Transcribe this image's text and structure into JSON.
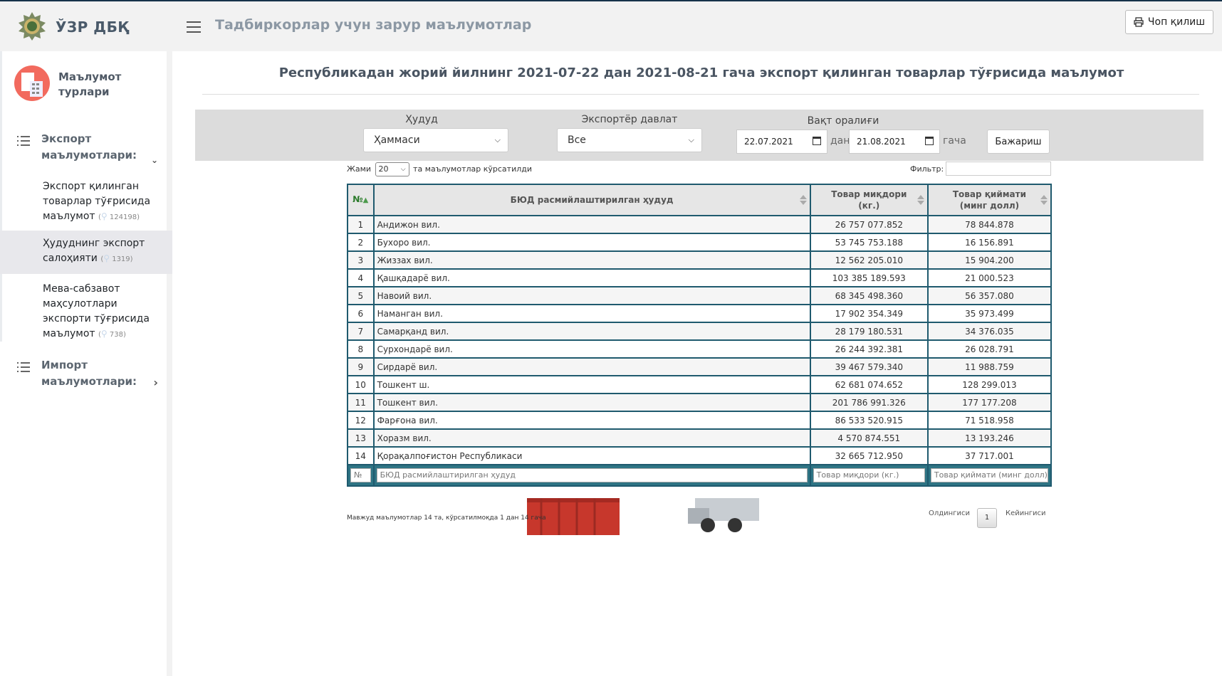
{
  "app": {
    "brand": "ЎЗР ДБҚ",
    "heading": "Тадбиркорлар учун зарур маълумотлар",
    "print_label": "Чоп қилиш"
  },
  "sidebar": {
    "title": "Маълумот турлари",
    "export_group": {
      "label": "Экспорт маълумотлари:"
    },
    "items": [
      {
        "label": "Экспорт қилинган товарлар тўғрисида маълумот",
        "count": "124198"
      },
      {
        "label": "Ҳududнинг экспорт салоҳияти",
        "count": "1319"
      },
      {
        "label": "Мева-сабзавот маҳсулотлари экспорти тўғрисида маълумот",
        "count": "738"
      }
    ],
    "import_group": {
      "label": "Импорт маълумотлари:"
    }
  },
  "main": {
    "title": "Республикадан жорий йилнинг 2021-07-22 дан 2021-08-21 гача экспорт қилинган товарлар тўғрисида маълумот",
    "filters": {
      "region_label": "Ҳудуд",
      "region_value": "Ҳаммаси",
      "country_label": "Экспортёр давлат",
      "country_value": "Все",
      "period_label": "Вақт оралиғи",
      "date_from": "22.07.2021",
      "from_text": "дан",
      "date_to": "21.08.2021",
      "to_text": "гача",
      "run_label": "Бажариш"
    },
    "table_controls": {
      "show_prefix": "Жами",
      "page_size": "20",
      "show_suffix": "та маълумотлар кўрсатилди",
      "filter_label": "Фильтр:"
    },
    "table": {
      "headers": {
        "num": "№",
        "region": "БЮД расмийлаштирилган ҳудуд",
        "qty": "Товар миқдори (кг.)",
        "value": "Товар қиймати (минг долл)"
      },
      "rows": [
        {
          "n": "1",
          "region": "Андижон вил.",
          "qty": "26 757 077.852",
          "value": "78 844.878"
        },
        {
          "n": "2",
          "region": "Бухоро вил.",
          "qty": "53 745 753.188",
          "value": "16 156.891"
        },
        {
          "n": "3",
          "region": "Жиззах вил.",
          "qty": "12 562 205.010",
          "value": "15 904.200"
        },
        {
          "n": "4",
          "region": "Қашқадарё вил.",
          "qty": "103 385 189.593",
          "value": "21 000.523"
        },
        {
          "n": "5",
          "region": "Навоий вил.",
          "qty": "68 345 498.360",
          "value": "56 357.080"
        },
        {
          "n": "6",
          "region": "Наманган вил.",
          "qty": "17 902 354.349",
          "value": "35 973.499"
        },
        {
          "n": "7",
          "region": "Самарқанд вил.",
          "qty": "28 179 180.531",
          "value": "34 376.035"
        },
        {
          "n": "8",
          "region": "Сурхондарё вил.",
          "qty": "26 244 392.381",
          "value": "26 028.791"
        },
        {
          "n": "9",
          "region": "Сирдарё вил.",
          "qty": "39 467 579.340",
          "value": "11 988.759"
        },
        {
          "n": "10",
          "region": "Тошкент ш.",
          "qty": "62 681 074.652",
          "value": "128 299.013"
        },
        {
          "n": "11",
          "region": "Тошкент вил.",
          "qty": "201 786 991.326",
          "value": "177 177.208"
        },
        {
          "n": "12",
          "region": "Фарғона вил.",
          "qty": "86 533 520.915",
          "value": "71 518.958"
        },
        {
          "n": "13",
          "region": "Хоразм вил.",
          "qty": "4 570 874.551",
          "value": "13 193.246"
        },
        {
          "n": "14",
          "region": "Қорақалпоғистон Республикаси",
          "qty": "32 665 712.950",
          "value": "37 717.001"
        }
      ],
      "footer_placeholders": {
        "num": "№",
        "region": "БЮД расмийлаштирилган ҳудуд",
        "qty": "Товар миқдори (кг.)",
        "value": "Товар қиймати (минг долл)"
      }
    },
    "info": "Мавжуд маълумотлар 14 та, кўрсатилмоқда 1 дан 14 гача",
    "pagination": {
      "prev": "Олдингиси",
      "current": "1",
      "next": "Кейингиси"
    }
  },
  "colors": {
    "table_border": "#1f5a6e",
    "table_footer": "#2e7484",
    "accent_logo": "#4a6f3a",
    "avatar": "#f26a5e"
  }
}
